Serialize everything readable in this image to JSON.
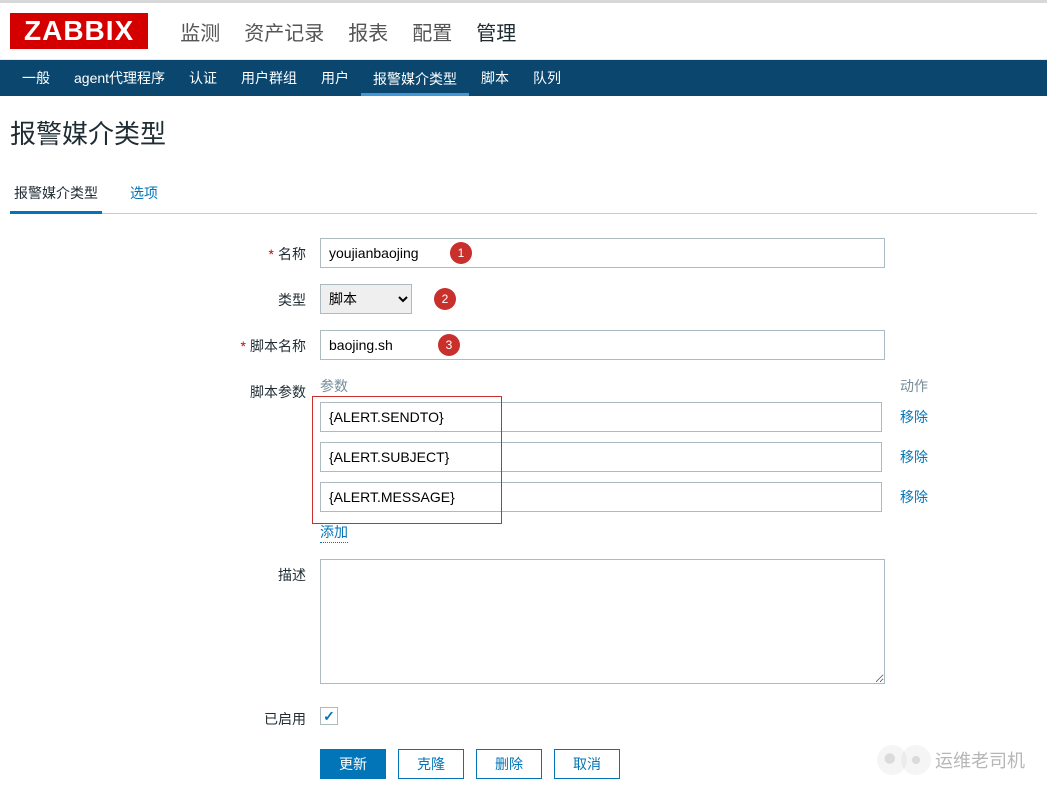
{
  "logo": "ZABBIX",
  "top_menu": [
    "监测",
    "资产记录",
    "报表",
    "配置",
    "管理"
  ],
  "top_menu_active": 4,
  "sub_menu": [
    "一般",
    "agent代理程序",
    "认证",
    "用户群组",
    "用户",
    "报警媒介类型",
    "脚本",
    "队列"
  ],
  "sub_menu_active": 5,
  "page_title": "报警媒介类型",
  "tabs": [
    "报警媒介类型",
    "选项"
  ],
  "tabs_active": 0,
  "labels": {
    "name": "名称",
    "type": "类型",
    "script_name": "脚本名称",
    "script_params": "脚本参数",
    "params_col": "参数",
    "action_col": "动作",
    "remove": "移除",
    "add": "添加",
    "description": "描述",
    "enabled": "已启用"
  },
  "values": {
    "name": "youjianbaojing",
    "type": "脚本",
    "script_name": "baojing.sh",
    "params": [
      "{ALERT.SENDTO}",
      "{ALERT.SUBJECT}",
      "{ALERT.MESSAGE}"
    ],
    "description": "",
    "enabled": true
  },
  "badges": {
    "name": "1",
    "type": "2",
    "script_name": "3"
  },
  "buttons": {
    "update": "更新",
    "clone": "克隆",
    "delete": "删除",
    "cancel": "取消"
  },
  "watermark": "运维老司机"
}
